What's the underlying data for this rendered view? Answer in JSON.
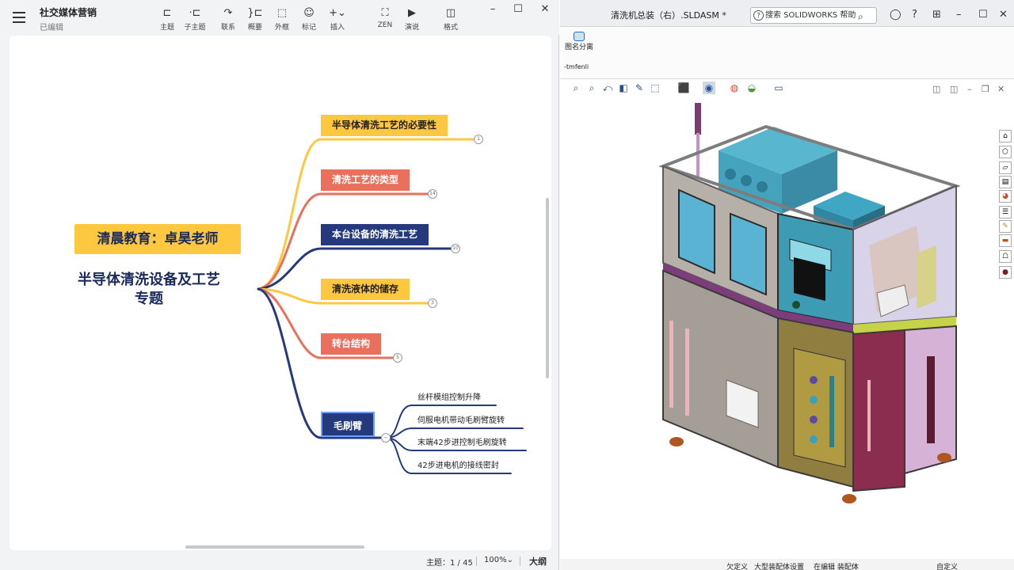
{
  "xmind": {
    "doc_title": "社交媒体营销",
    "doc_status": "已编辑",
    "toolbar": [
      {
        "label": "主题",
        "icon": "topic-icon",
        "glyph": "⊏"
      },
      {
        "label": "子主题",
        "icon": "subtopic-icon",
        "glyph": "⋅⊏"
      },
      {
        "label": "联系",
        "icon": "relationship-icon",
        "glyph": "↷"
      },
      {
        "label": "概要",
        "icon": "summary-icon",
        "glyph": "}⊏"
      },
      {
        "label": "外框",
        "icon": "boundary-icon",
        "glyph": "⬚"
      },
      {
        "label": "标记",
        "icon": "marker-icon",
        "glyph": "☺"
      },
      {
        "label": "插入",
        "icon": "insert-icon",
        "glyph": "+⌄"
      },
      {
        "label": "ZEN",
        "icon": "zen-icon",
        "glyph": "⛶"
      },
      {
        "label": "演说",
        "icon": "pitch-icon",
        "glyph": "▶"
      },
      {
        "label": "格式",
        "icon": "format-icon",
        "glyph": "◫"
      }
    ],
    "banner": "清晨教育：卓昊老师",
    "central_topic": "半导体清洗设备及工艺专题",
    "central_topic_line1": "半导体清洗设备及工艺",
    "central_topic_line2": "专题",
    "branches": [
      {
        "label": "半导体清洗工艺的必要性",
        "color": "yellow",
        "badge": "1"
      },
      {
        "label": "清洗工艺的类型",
        "color": "red",
        "badge": "14"
      },
      {
        "label": "本台设备的清洗工艺",
        "color": "navy",
        "badge": "10"
      },
      {
        "label": "清洗液体的储存",
        "color": "yellow",
        "badge": "3"
      },
      {
        "label": "转台结构",
        "color": "red",
        "badge": "5"
      },
      {
        "label": "毛刷臂",
        "color": "navy",
        "badge": "−"
      }
    ],
    "subtopics": [
      "丝杆模组控制升降",
      "伺服电机带动毛刷臂旋转",
      "末端42步进控制毛刷旋转",
      "42步进电机的接线密封"
    ],
    "status": {
      "topics": "主题：1 / 45",
      "zoom": "100%⌄",
      "outline": "大纲"
    },
    "colors": {
      "yellow": "#fdc840",
      "red": "#e8705c",
      "navy": "#243a7c"
    }
  },
  "solidworks": {
    "title": "清洗机总装（右）.SLDASM *",
    "search_placeholder": "搜索 SOLIDWORKS 帮助",
    "command_button": "图名分离",
    "command_sub": "-tmfenli",
    "status": {
      "left": "欠定义",
      "mid1": "大型装配体设置",
      "mid2": "在编辑 装配体",
      "right": "自定义"
    }
  }
}
